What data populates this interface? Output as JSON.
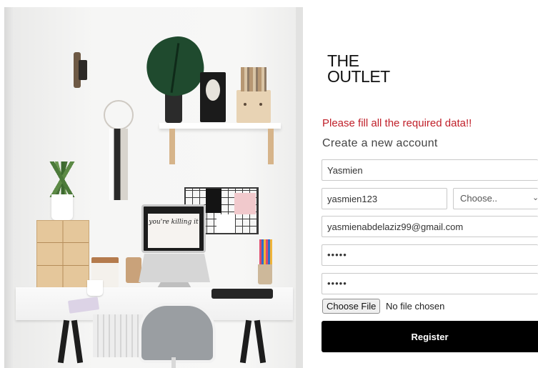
{
  "brand": {
    "logo_line1": "THE",
    "logo_line2": "OUTLET"
  },
  "form": {
    "error_message": "Please fill all the required data!!",
    "heading": "Create a new account",
    "fields": {
      "full_name": "Yasmien",
      "username": "yasmien123",
      "select_selected": "Choose..",
      "email": "yasmienabdelaziz99@gmail.com",
      "password_mask": "•••••",
      "confirm_password_mask": "•••••"
    },
    "file": {
      "button_label": "Choose File",
      "status": "No file chosen"
    },
    "submit_label": "Register"
  },
  "photo": {
    "screen_text": "you're killing it"
  },
  "colors": {
    "error": "#c0202a",
    "button_bg": "#000000",
    "text": "#444444"
  }
}
